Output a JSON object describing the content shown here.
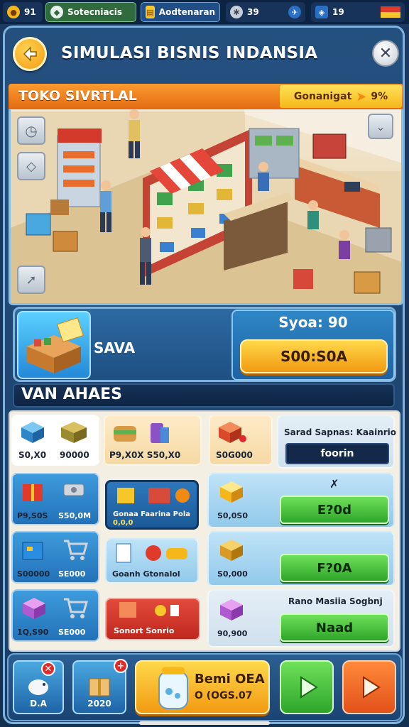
{
  "status_bar": {
    "coins": "91",
    "tab_one": "Sotecniacis",
    "tab_two": "Aodtenaran",
    "stat_one": "39",
    "stat_two": "19"
  },
  "header": {
    "title": "SIMULASI BISNIS INDANSIA",
    "back_icon": "arrow-left-icon",
    "close_icon": "close-icon"
  },
  "store": {
    "banner_title": "TOKO SIVRTLAL",
    "growth_label": "Gonanigat",
    "growth_value": "9%"
  },
  "product": {
    "name": "SAVA",
    "stock_label": "Syoa: 90",
    "price_button": "S00:S0A"
  },
  "section": {
    "title": "VAN AHAES"
  },
  "grid": {
    "row1": {
      "a_val1": "S0,X0",
      "a_val2": "90000",
      "b_val": "P9,X0X S50,X0",
      "c_val": "S0G000",
      "panel_title": "Sarad Sapnas: Kaainrio",
      "panel_button": "foorin"
    },
    "row2": {
      "a_val1": "P9,S0S",
      "a_val2": "S50,0M",
      "b_label": "Gonaa Faarina Pola",
      "b_sub": "0,0,0",
      "c_val": "S0,0S0",
      "button": "E?0d"
    },
    "row3": {
      "a_val1": "S00000",
      "a_val2": "SE000",
      "b_label": "Goanh Gtonalol",
      "c_val": "S0,000",
      "button": "F?0A"
    },
    "row4": {
      "a_val1": "1Q,S90",
      "a_val2": "SE000",
      "b_label": "Sonort Sonrio",
      "panel_title": "Rano Masiia Sogbnj",
      "c_val": "90,900",
      "button": "Naad"
    }
  },
  "bottom_bar": {
    "btn1_label": "D.A",
    "btn2_label": "2020",
    "main_title": "Bemi OEA",
    "main_sub": "O (OGS.07"
  },
  "colors": {
    "accent_orange": "#f39a12",
    "accent_green": "#2ea52a",
    "panel_blue": "#1e4f82"
  }
}
